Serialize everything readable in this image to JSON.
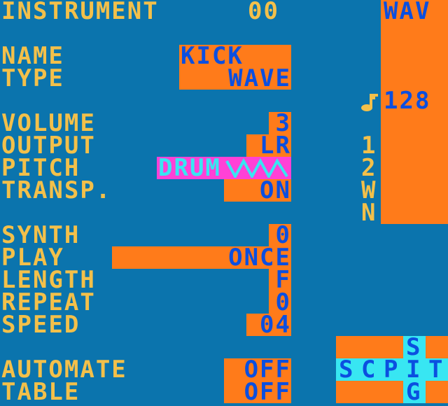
{
  "header": {
    "title": "INSTRUMENT",
    "number": "00"
  },
  "fields": {
    "name_label": "NAME",
    "name_value": "KICK",
    "type_label": "TYPE",
    "type_value": "WAVE",
    "volume_label": "VOLUME",
    "volume_value": "3",
    "output_label": "OUTPUT",
    "output_value": "LR",
    "pitch_label": "PITCH",
    "pitch_value": "DRUM",
    "transp_label": "TRANSP.",
    "transp_value": "ON",
    "synth_label": "SYNTH",
    "synth_value": "0",
    "play_label": "PLAY",
    "play_value": "ONCE",
    "length_label": "LENGTH",
    "length_value": "F",
    "repeat_label": "REPEAT",
    "repeat_value": "0",
    "speed_label": "SPEED",
    "speed_value": "04",
    "automate_label": "AUTOMATE",
    "automate_value": "OFF",
    "table_label": "TABLE",
    "table_value": "OFF"
  },
  "side": {
    "mode": "WAV",
    "tempo_icon": "note-icon",
    "tempo": "128",
    "ch1": "1",
    "ch2": "2",
    "ch3": "W",
    "ch4": "N"
  },
  "screen_map": {
    "s": "S",
    "c": "C",
    "p": "P",
    "i": "I",
    "t": "T",
    "s2": "S",
    "g": "G"
  },
  "colors": {
    "background": "#0b74ad",
    "text": "#f3c04a",
    "value": "#0b4fe0",
    "highlight": "#ff7b1a",
    "cursor": "#ff41d6",
    "cursor_text": "#38e6f2"
  }
}
